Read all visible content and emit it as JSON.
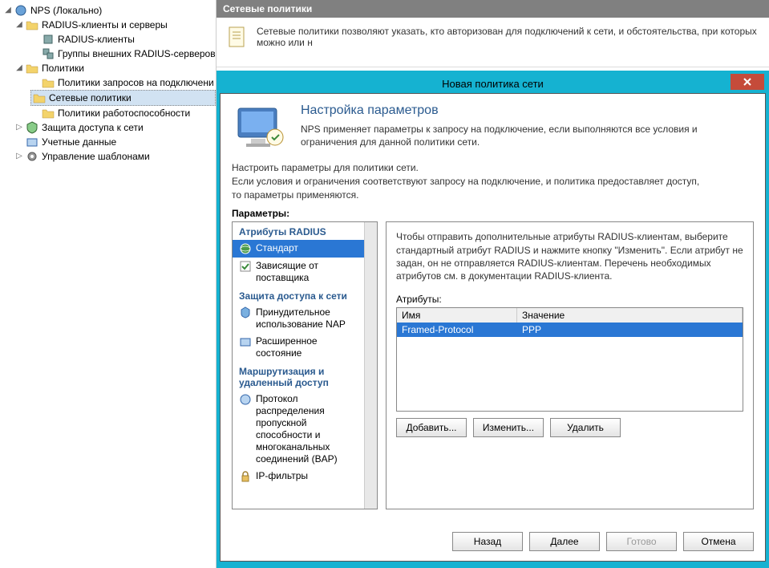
{
  "tree": {
    "root": "NPS (Локально)",
    "radius_group": "RADIUS-клиенты и серверы",
    "radius_clients": "RADIUS-клиенты",
    "radius_groups": "Группы внешних RADIUS-серверов",
    "policies": "Политики",
    "policy_conn": "Политики запросов на подключени",
    "policy_net": "Сетевые политики",
    "policy_health": "Политики работоспособности",
    "nap": "Защита доступа к сети",
    "accounting": "Учетные данные",
    "templates": "Управление шаблонами"
  },
  "content": {
    "header": "Сетевые политики",
    "description": "Сетевые политики позволяют указать, кто авторизован для подключений к сети, и обстоятельства, при которых можно или н"
  },
  "dialog": {
    "title": "Новая политика сети",
    "wizard_title": "Настройка параметров",
    "wizard_sub": "NPS применяет параметры к запросу на подключение, если выполняются все условия и ограничения для данной политики сети.",
    "guide1": "Настроить параметры для политики сети.",
    "guide2": "Если условия и ограничения соответствуют запросу на подключение, и политика предоставляет доступ,",
    "guide3": "то параметры применяются.",
    "params_label": "Параметры:",
    "categories": {
      "sec_radius": "Атрибуты RADIUS",
      "standard": "Стандарт",
      "vendor": "Зависящие от поставщика",
      "sec_nap": "Защита доступа к сети",
      "nap_enforce": "Принудительное использование NAP",
      "ext_state": "Расширенное состояние",
      "sec_routing": "Маршрутизация и удаленный доступ",
      "bap": "Протокол распределения пропускной способности и многоканальных соединений (BAP)",
      "ip_filters": "IP-фильтры"
    },
    "detail_text": "Чтобы отправить дополнительные атрибуты RADIUS-клиентам, выберите стандартный атрибут RADIUS и нажмите кнопку \"Изменить\". Если атрибут не задан, он не отправляется RADIUS-клиентам. Перечень необходимых атрибутов см. в документации RADIUS-клиента.",
    "attributes_label": "Атрибуты:",
    "col_name": "Имя",
    "col_value": "Значение",
    "row_name": "Framed-Protocol",
    "row_value": "PPP",
    "btn_add": "Добавить...",
    "btn_edit": "Изменить...",
    "btn_delete": "Удалить",
    "btn_back": "Назад",
    "btn_next": "Далее",
    "btn_finish": "Готово",
    "btn_cancel": "Отмена"
  }
}
